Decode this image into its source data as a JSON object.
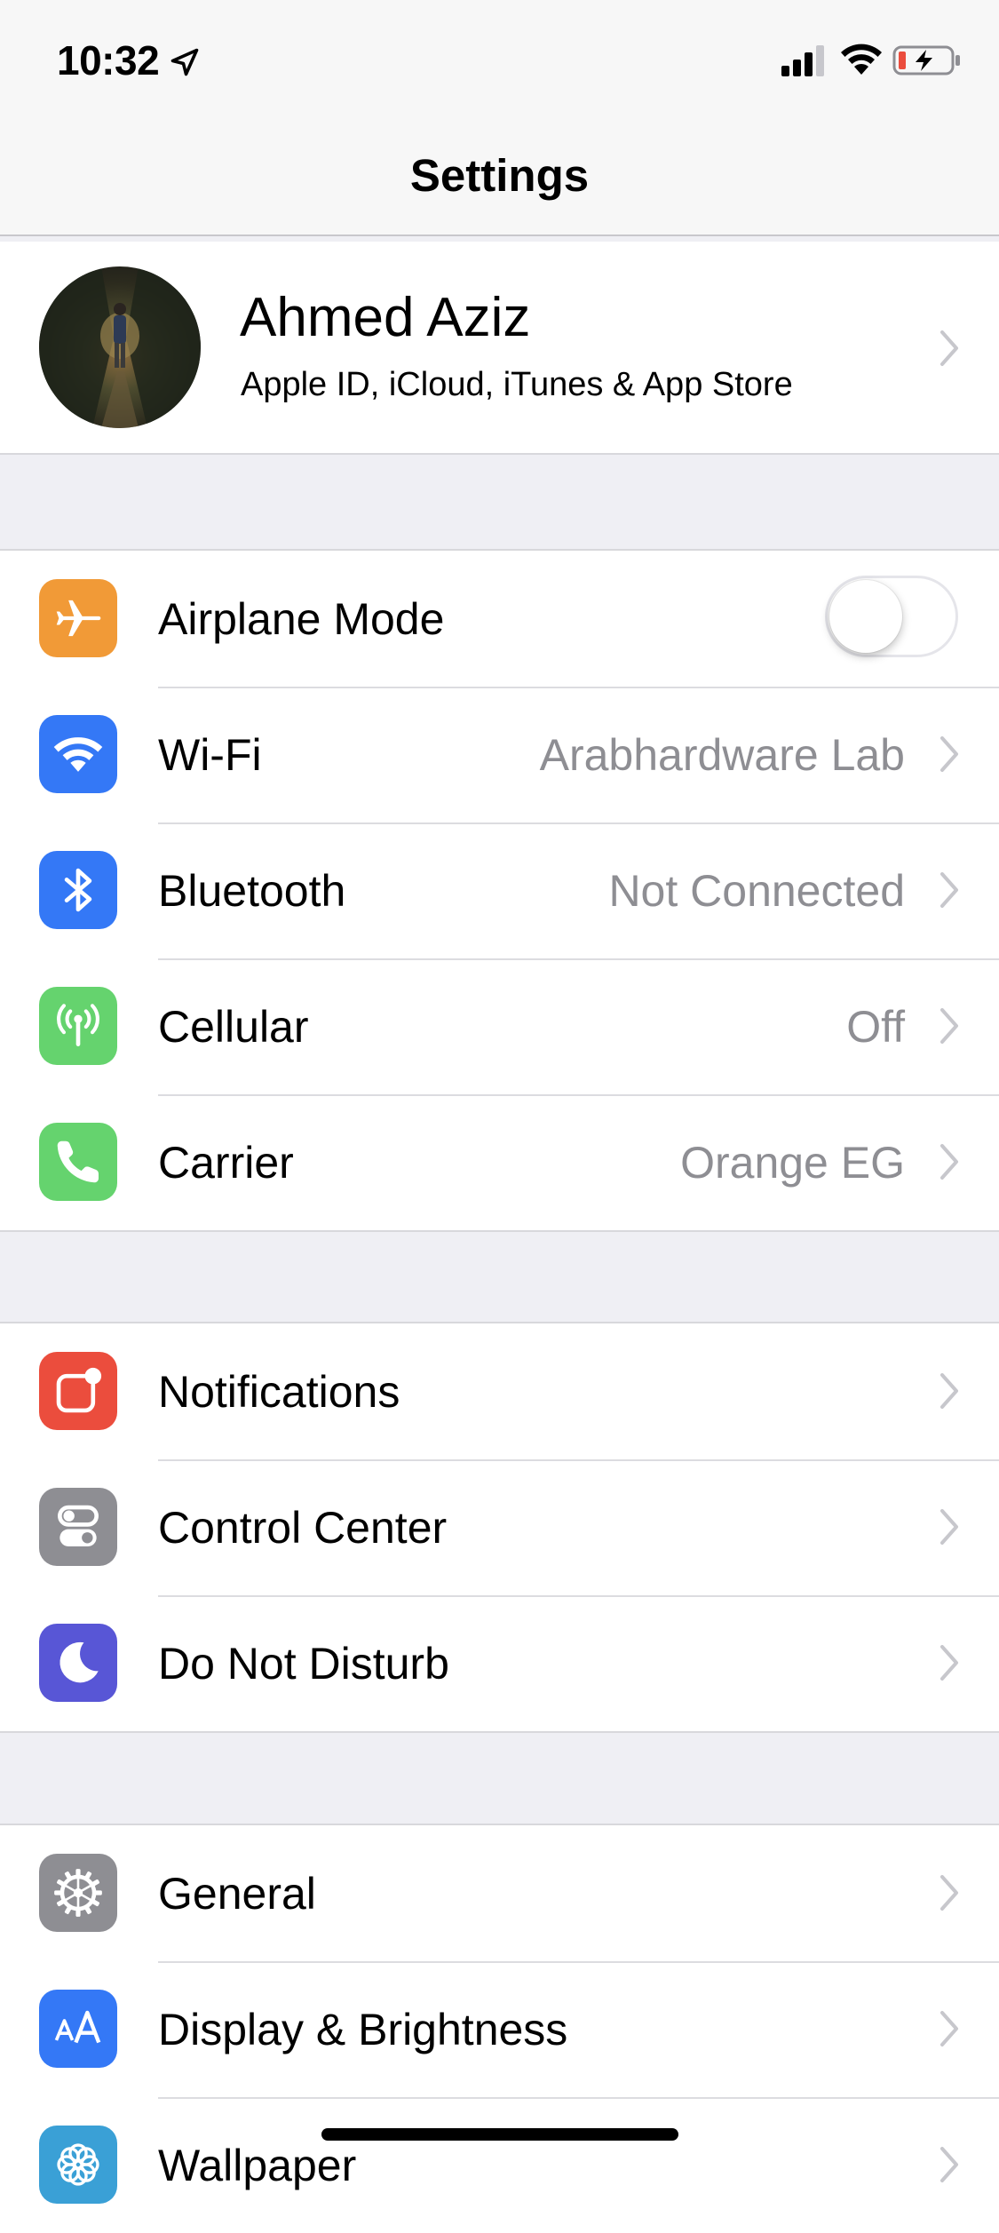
{
  "status_bar": {
    "time": "10:32",
    "location_icon": "location-arrow-icon",
    "signal_icon": "cellular-signal-icon",
    "wifi_icon": "wifi-icon",
    "battery_icon": "battery-charging-icon"
  },
  "nav": {
    "title": "Settings"
  },
  "profile": {
    "name": "Ahmed Aziz",
    "subtitle": "Apple ID, iCloud, iTunes & App Store"
  },
  "groups": [
    {
      "rows": [
        {
          "label": "Airplane Mode",
          "icon": "airplane-icon",
          "color": "#f19a37",
          "toggle": false
        },
        {
          "label": "Wi-Fi",
          "icon": "wifi-icon",
          "color": "#3478f6",
          "value": "Arabhardware Lab"
        },
        {
          "label": "Bluetooth",
          "icon": "bluetooth-icon",
          "color": "#3478f6",
          "value": "Not Connected"
        },
        {
          "label": "Cellular",
          "icon": "antenna-icon",
          "color": "#65d36e",
          "value": "Off"
        },
        {
          "label": "Carrier",
          "icon": "phone-icon",
          "color": "#65d36e",
          "value": "Orange EG"
        }
      ]
    },
    {
      "rows": [
        {
          "label": "Notifications",
          "icon": "notifications-icon",
          "color": "#eb4d3d"
        },
        {
          "label": "Control Center",
          "icon": "control-center-icon",
          "color": "#8e8e93"
        },
        {
          "label": "Do Not Disturb",
          "icon": "moon-icon",
          "color": "#5856d6"
        }
      ]
    },
    {
      "rows": [
        {
          "label": "General",
          "icon": "gear-icon",
          "color": "#8e8e93"
        },
        {
          "label": "Display & Brightness",
          "icon": "text-size-icon",
          "color": "#3478f6"
        },
        {
          "label": "Wallpaper",
          "icon": "wallpaper-flower-icon",
          "color": "#3aa0d6"
        }
      ]
    }
  ],
  "colors": {
    "background": "#efeff4",
    "secondary_text": "#8e8e93",
    "chevron": "#c7c7cc"
  }
}
